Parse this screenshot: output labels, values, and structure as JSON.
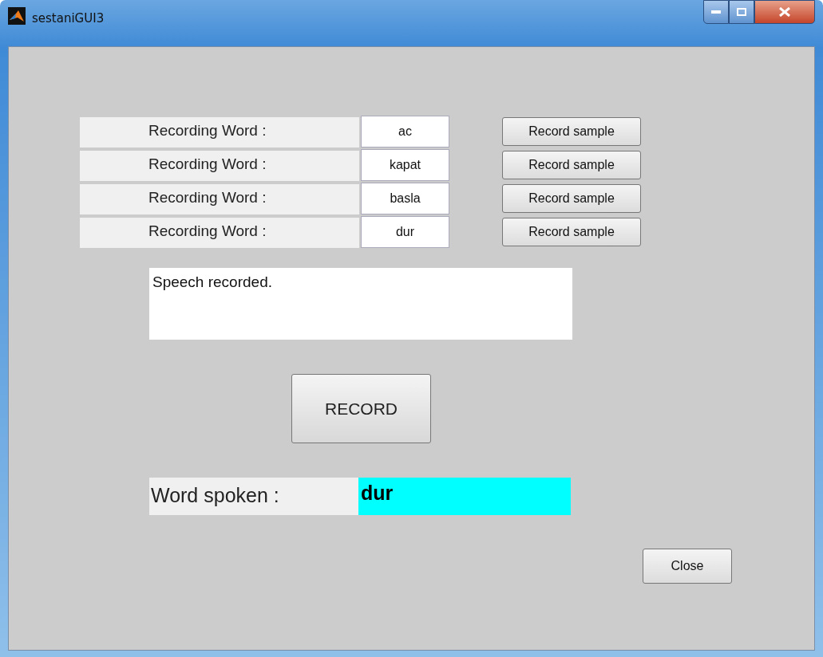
{
  "window": {
    "title": "sestaniGUI3"
  },
  "samples": [
    {
      "label": "Recording Word :",
      "value": "ac",
      "button": "Record sample"
    },
    {
      "label": "Recording Word :",
      "value": "kapat",
      "button": "Record sample"
    },
    {
      "label": "Recording Word :",
      "value": "basla",
      "button": "Record sample"
    },
    {
      "label": "Recording Word :",
      "value": "dur",
      "button": "Record sample"
    }
  ],
  "status": {
    "text": "Speech recorded."
  },
  "record_button": "RECORD",
  "result": {
    "label": "Word spoken :",
    "value": "dur"
  },
  "close_button": "Close"
}
